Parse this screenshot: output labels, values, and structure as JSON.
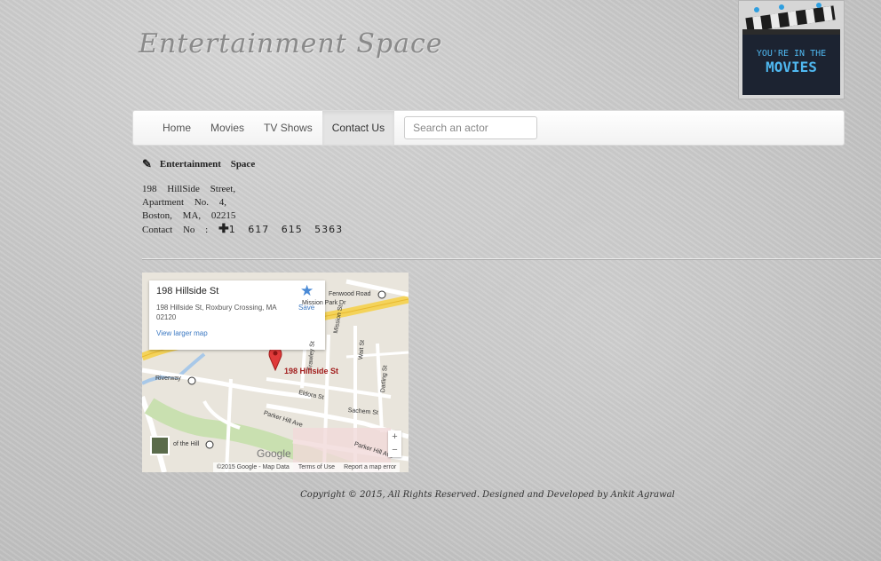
{
  "header": {
    "site_title": "Entertainment Space",
    "logo_text_line1": "YOU'RE IN THE",
    "logo_text_line2": "MOVIES"
  },
  "nav": {
    "items": [
      {
        "label": "Home"
      },
      {
        "label": "Movies"
      },
      {
        "label": "TV Shows"
      },
      {
        "label": "Contact Us",
        "active": true
      }
    ],
    "search_placeholder": "Search an actor"
  },
  "contact": {
    "heading": "Entertainment Space",
    "address_line1": "198 HillSide Street,",
    "address_line2": "Apartment No. 4,",
    "address_line3": "Boston, MA, 02215",
    "contact_label": "Contact No :",
    "phone": "1 617 615 5363"
  },
  "map": {
    "place_title": "198 Hillside St",
    "place_address": "198 Hillside St, Roxbury Crossing, MA 02120",
    "save_label": "Save",
    "view_larger_label": "View larger map",
    "pin_label": "198 Hillside St",
    "street_labels": {
      "mission_park": "Mission Park Dr",
      "fenwood": "Fenwood Road",
      "mission_st": "Mission St",
      "frawley": "Frawley St",
      "wait": "Wait St",
      "darling": "Darling St",
      "riverway": "Riverway",
      "eldora": "Eldora St",
      "sachem": "Sachem St",
      "parker_hill": "Parker Hill Ave",
      "parker_hill_2": "Parker Hill Ave",
      "of_the_hill": "of the Hill"
    },
    "google_logo": "Google",
    "attribution": "©2015 Google - Map Data",
    "terms": "Terms of Use",
    "report": "Report a map error",
    "zoom_in": "+",
    "zoom_out": "−"
  },
  "footer": {
    "copyright": "Copyright © 2015, All Rights Reserved. Designed and Developed by Ankit Agrawal"
  }
}
